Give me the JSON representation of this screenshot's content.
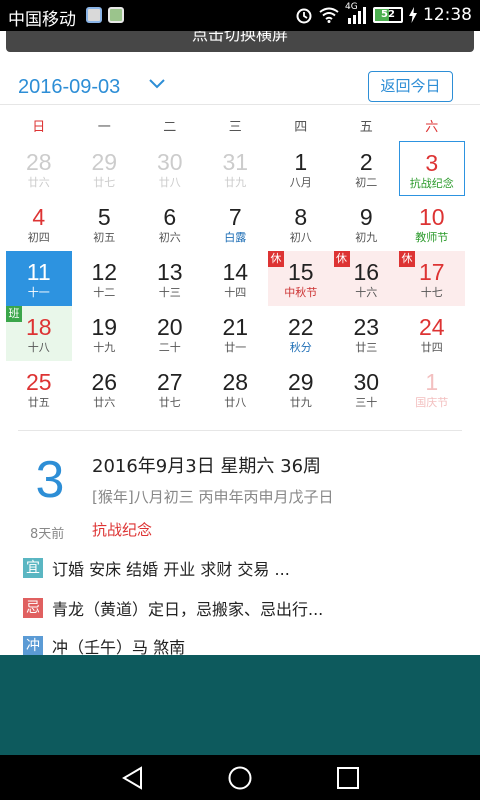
{
  "status_bar": {
    "carrier": "中国移动",
    "network": "4G",
    "battery": "52",
    "time": "12:38"
  },
  "banner": {
    "text": "点击切换横屏"
  },
  "header": {
    "date": "2016-09-03",
    "today_button": "返回今日"
  },
  "weekdays": [
    "日",
    "一",
    "二",
    "三",
    "四",
    "五",
    "六"
  ],
  "calendar": {
    "days": [
      {
        "num": "28",
        "lunar": "廿六",
        "cls": "other"
      },
      {
        "num": "29",
        "lunar": "廿七",
        "cls": "other"
      },
      {
        "num": "30",
        "lunar": "廿八",
        "cls": "other"
      },
      {
        "num": "31",
        "lunar": "廿九",
        "cls": "other"
      },
      {
        "num": "1",
        "lunar": "八月",
        "cls": ""
      },
      {
        "num": "2",
        "lunar": "初二",
        "cls": ""
      },
      {
        "num": "3",
        "lunar": "抗战纪念",
        "cls": "weekend fest-green selected"
      },
      {
        "num": "4",
        "lunar": "初四",
        "cls": "weekend"
      },
      {
        "num": "5",
        "lunar": "初五",
        "cls": ""
      },
      {
        "num": "6",
        "lunar": "初六",
        "cls": ""
      },
      {
        "num": "7",
        "lunar": "白露",
        "cls": "term"
      },
      {
        "num": "8",
        "lunar": "初八",
        "cls": ""
      },
      {
        "num": "9",
        "lunar": "初九",
        "cls": ""
      },
      {
        "num": "10",
        "lunar": "教师节",
        "cls": "weekend fest-green"
      },
      {
        "num": "11",
        "lunar": "十一",
        "cls": "today"
      },
      {
        "num": "12",
        "lunar": "十二",
        "cls": ""
      },
      {
        "num": "13",
        "lunar": "十三",
        "cls": ""
      },
      {
        "num": "14",
        "lunar": "十四",
        "cls": ""
      },
      {
        "num": "15",
        "lunar": "中秋节",
        "cls": "holiday fest",
        "tag": "休"
      },
      {
        "num": "16",
        "lunar": "十六",
        "cls": "holiday",
        "tag": "休"
      },
      {
        "num": "17",
        "lunar": "十七",
        "cls": "holiday weekend",
        "tag": "休"
      },
      {
        "num": "18",
        "lunar": "十八",
        "cls": "workday weekend",
        "tag": "班"
      },
      {
        "num": "19",
        "lunar": "十九",
        "cls": ""
      },
      {
        "num": "20",
        "lunar": "二十",
        "cls": ""
      },
      {
        "num": "21",
        "lunar": "廿一",
        "cls": ""
      },
      {
        "num": "22",
        "lunar": "秋分",
        "cls": "term"
      },
      {
        "num": "23",
        "lunar": "廿三",
        "cls": ""
      },
      {
        "num": "24",
        "lunar": "廿四",
        "cls": "weekend"
      },
      {
        "num": "25",
        "lunar": "廿五",
        "cls": "weekend"
      },
      {
        "num": "26",
        "lunar": "廿六",
        "cls": ""
      },
      {
        "num": "27",
        "lunar": "廿七",
        "cls": ""
      },
      {
        "num": "28",
        "lunar": "廿八",
        "cls": ""
      },
      {
        "num": "29",
        "lunar": "廿九",
        "cls": ""
      },
      {
        "num": "30",
        "lunar": "三十",
        "cls": ""
      },
      {
        "num": "1",
        "lunar": "国庆节",
        "cls": "other fest"
      }
    ]
  },
  "detail": {
    "day": "3",
    "days_ago": "8天前",
    "full_date": "2016年9月3日 星期六 36周",
    "lunar": "[猴年]八月初三 丙申年丙申月戊子日",
    "festival": "抗战纪念",
    "yi_label": "宜",
    "yi_text": "订婚  安床  结婚  开业  求财  交易  ...",
    "ji_label": "忌",
    "ji_text": "青龙（黄道）定日，忌搬家、忌出行...",
    "chong_label": "冲",
    "chong_text": "冲（壬午）马  煞南"
  }
}
